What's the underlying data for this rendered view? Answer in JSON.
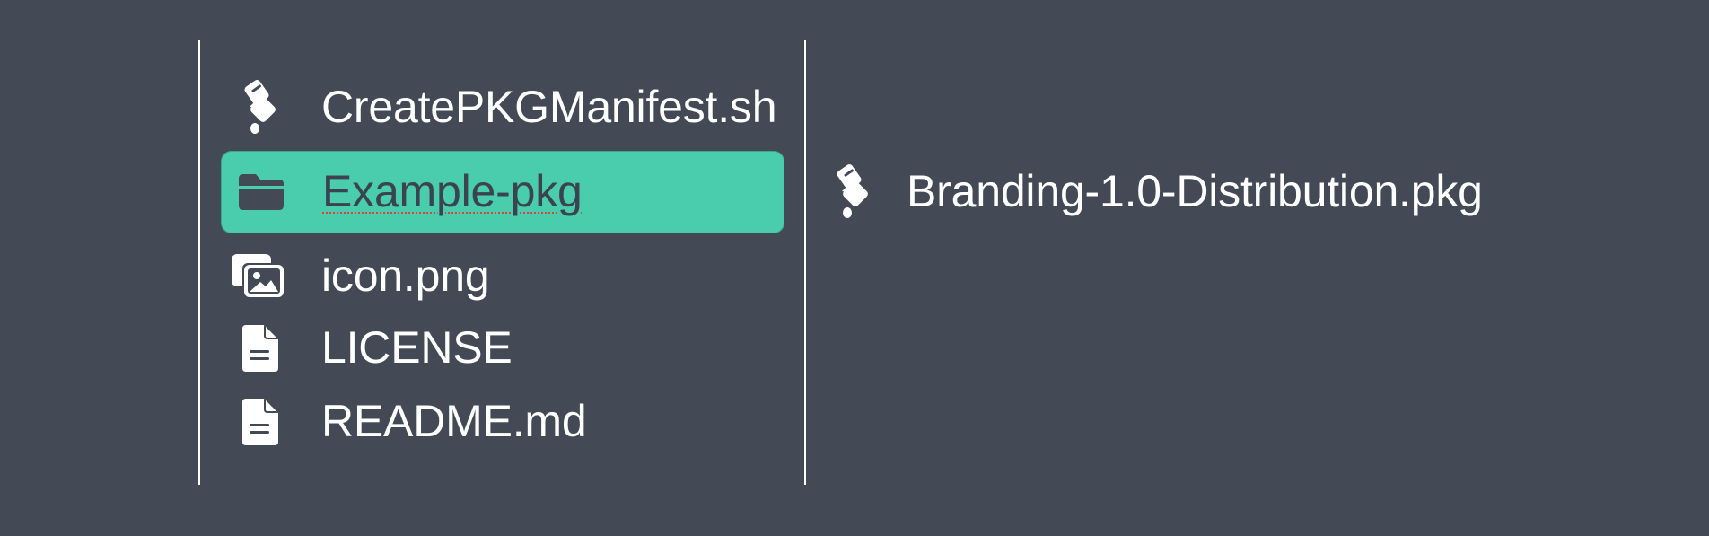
{
  "left_list": {
    "items": [
      {
        "name": "CreatePKGManifest.sh",
        "icon": "script-icon",
        "selected": false
      },
      {
        "name": "Example-pkg",
        "icon": "folder-icon",
        "selected": true
      },
      {
        "name": "icon.png",
        "icon": "images-icon",
        "selected": false
      },
      {
        "name": "LICENSE",
        "icon": "document-icon",
        "selected": false
      },
      {
        "name": "README.md",
        "icon": "document-icon",
        "selected": false
      }
    ]
  },
  "right_list": {
    "items": [
      {
        "name": "Branding-1.0-Distribution.pkg",
        "icon": "script-icon",
        "selected": false
      }
    ]
  },
  "colors": {
    "background": "#434a56",
    "selection": "#4acdad",
    "text": "#ffffff",
    "selected_text": "#3b4350"
  }
}
